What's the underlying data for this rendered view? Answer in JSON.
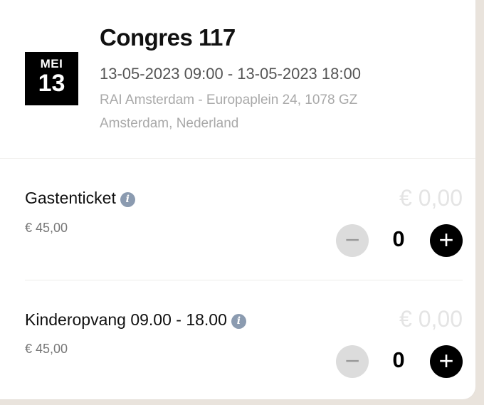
{
  "event": {
    "month": "MEI",
    "day": "13",
    "title": "Congres 117",
    "datetime": "13-05-2023 09:00 - 13-05-2023 18:00",
    "location": "RAI Amsterdam - Europaplein 24, 1078 GZ Amsterdam, Nederland"
  },
  "tickets": [
    {
      "name": "Gastenticket",
      "price": "€ 45,00",
      "total": "€ 0,00",
      "quantity": "0",
      "minus": "−",
      "plus": "+"
    },
    {
      "name": "Kinderopvang 09.00 - 18.00",
      "price": "€ 45,00",
      "total": "€ 0,00",
      "quantity": "0",
      "minus": "−",
      "plus": "+"
    }
  ],
  "icons": {
    "info": "i"
  }
}
